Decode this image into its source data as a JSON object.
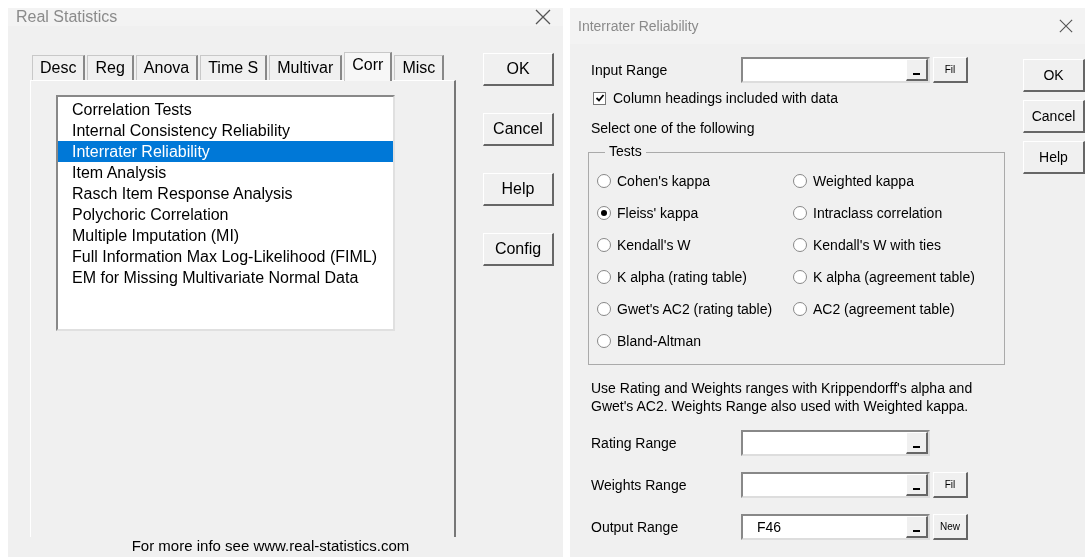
{
  "main_dialog": {
    "title": "Real Statistics",
    "tabs": [
      {
        "label": "Desc",
        "selected": false
      },
      {
        "label": "Reg",
        "selected": false
      },
      {
        "label": "Anova",
        "selected": false
      },
      {
        "label": "Time S",
        "selected": false
      },
      {
        "label": "Multivar",
        "selected": false
      },
      {
        "label": "Corr",
        "selected": true
      },
      {
        "label": "Misc",
        "selected": false
      }
    ],
    "list_items": [
      {
        "label": "Correlation Tests",
        "selected": false
      },
      {
        "label": "Internal Consistency Reliability",
        "selected": false
      },
      {
        "label": "Interrater Reliability",
        "selected": true
      },
      {
        "label": "Item Analysis",
        "selected": false
      },
      {
        "label": "Rasch Item Response Analysis",
        "selected": false
      },
      {
        "label": "Polychoric Correlation",
        "selected": false
      },
      {
        "label": "Multiple Imputation (MI)",
        "selected": false
      },
      {
        "label": "Full Information Max Log-Likelihood (FIML)",
        "selected": false
      },
      {
        "label": "EM for Missing Multivariate Normal Data",
        "selected": false
      }
    ],
    "buttons": [
      "OK",
      "Cancel",
      "Help",
      "Config"
    ],
    "footer": "For more info see www.real-statistics.com"
  },
  "interrater_dialog": {
    "title": "Interrater Reliability",
    "input_range": {
      "label": "Input Range",
      "extra_button": "Fil"
    },
    "column_headings": {
      "label": "Column headings included with data",
      "checked": true
    },
    "select_prompt": "Select one of the following",
    "tests": {
      "legend": "Tests",
      "options": [
        {
          "label": "Cohen's kappa",
          "selected": false
        },
        {
          "label": "Weighted kappa",
          "selected": false
        },
        {
          "label": "Fleiss' kappa",
          "selected": true
        },
        {
          "label": "Intraclass correlation",
          "selected": false
        },
        {
          "label": "Kendall's W",
          "selected": false
        },
        {
          "label": "Kendall's W with ties",
          "selected": false
        },
        {
          "label": "K alpha (rating table)",
          "selected": false
        },
        {
          "label": "K alpha (agreement table)",
          "selected": false
        },
        {
          "label": "Gwet's AC2 (rating table)",
          "selected": false
        },
        {
          "label": "AC2 (agreement table)",
          "selected": false
        },
        {
          "label": "Bland-Altman",
          "selected": false
        }
      ]
    },
    "note": "Use Rating and Weights ranges with Krippendorff's alpha and Gwet's AC2. Weights Range also used with Weighted kappa.",
    "ranges": [
      {
        "label": "Rating Range"
      },
      {
        "label": "Weights Range",
        "extra_button": "Fil"
      },
      {
        "label": "Output Range",
        "value": "F46",
        "extra_button": "New"
      }
    ],
    "buttons": [
      "OK",
      "Cancel",
      "Help"
    ]
  }
}
